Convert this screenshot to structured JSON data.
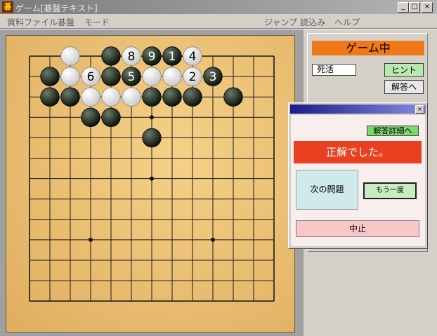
{
  "window": {
    "app_icon": "碁",
    "title": "ゲーム[碁盤テキスト]",
    "controls": [
      "_",
      "□",
      "×"
    ]
  },
  "menu": {
    "left": [
      "資料ファイル",
      "碁盤",
      "モード"
    ],
    "right": [
      "ジャンプ",
      "読込み",
      "ヘルプ"
    ]
  },
  "panel": {
    "status": "ゲーム中",
    "problem_type": "死活",
    "hint_label": "ヒント",
    "answer_label": "解答へ"
  },
  "dialog": {
    "close_label": "×",
    "detail_label": "解答詳細へ",
    "result": "正解でした。",
    "next_label": "次の問題",
    "again_label": "もう一度",
    "stop_label": "中止"
  },
  "board": {
    "size": 13,
    "star_points": [
      [
        6,
        3
      ],
      [
        3,
        9
      ],
      [
        9,
        9
      ],
      [
        6,
        6
      ]
    ],
    "stones": [
      {
        "col": 2,
        "row": 0,
        "color": "white"
      },
      {
        "col": 4,
        "row": 0,
        "color": "black"
      },
      {
        "col": 5,
        "row": 0,
        "color": "white",
        "label": "8"
      },
      {
        "col": 6,
        "row": 0,
        "color": "black",
        "label": "9"
      },
      {
        "col": 7,
        "row": 0,
        "color": "black",
        "label": "1"
      },
      {
        "col": 8,
        "row": 0,
        "color": "white",
        "label": "4"
      },
      {
        "col": 1,
        "row": 1,
        "color": "black"
      },
      {
        "col": 2,
        "row": 1,
        "color": "white"
      },
      {
        "col": 3,
        "row": 1,
        "color": "white",
        "label": "6"
      },
      {
        "col": 4,
        "row": 1,
        "color": "black"
      },
      {
        "col": 5,
        "row": 1,
        "color": "black",
        "label": "5"
      },
      {
        "col": 6,
        "row": 1,
        "color": "white"
      },
      {
        "col": 7,
        "row": 1,
        "color": "white"
      },
      {
        "col": 8,
        "row": 1,
        "color": "white",
        "label": "2"
      },
      {
        "col": 9,
        "row": 1,
        "color": "black",
        "label": "3"
      },
      {
        "col": 1,
        "row": 2,
        "color": "black"
      },
      {
        "col": 2,
        "row": 2,
        "color": "black"
      },
      {
        "col": 3,
        "row": 2,
        "color": "white"
      },
      {
        "col": 4,
        "row": 2,
        "color": "white"
      },
      {
        "col": 5,
        "row": 2,
        "color": "white"
      },
      {
        "col": 6,
        "row": 2,
        "color": "black"
      },
      {
        "col": 7,
        "row": 2,
        "color": "black"
      },
      {
        "col": 8,
        "row": 2,
        "color": "black"
      },
      {
        "col": 10,
        "row": 2,
        "color": "black"
      },
      {
        "col": 3,
        "row": 3,
        "color": "black"
      },
      {
        "col": 4,
        "row": 3,
        "color": "black"
      },
      {
        "col": 6,
        "row": 4,
        "color": "black"
      }
    ]
  }
}
